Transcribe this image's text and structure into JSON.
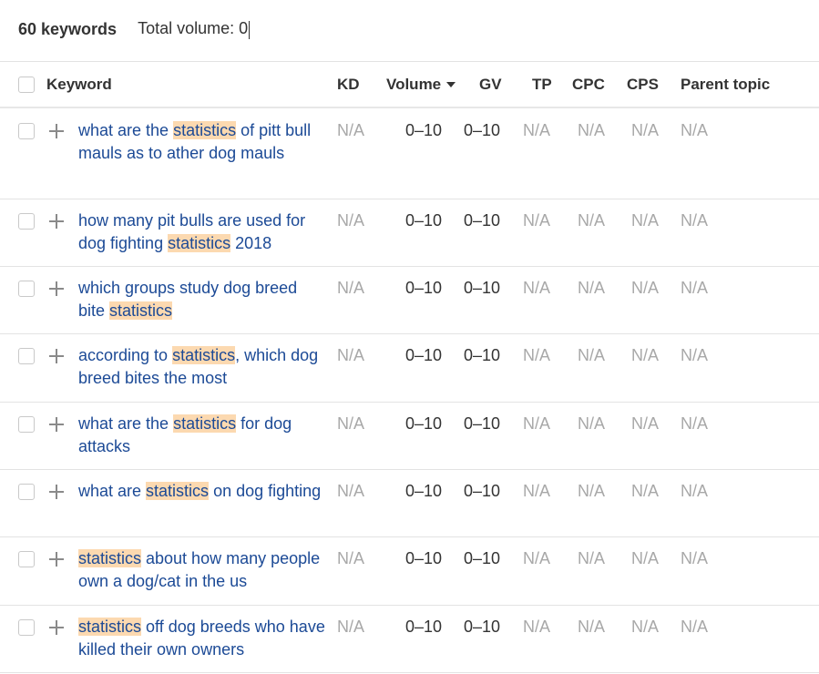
{
  "summary": {
    "keywords_count": "60 keywords",
    "total_volume_label": "Total volume: ",
    "total_volume_value": "0"
  },
  "columns": {
    "keyword": "Keyword",
    "kd": "KD",
    "volume": "Volume",
    "gv": "GV",
    "tp": "TP",
    "cpc": "CPC",
    "cps": "CPS",
    "parent_topic": "Parent topic"
  },
  "sort": {
    "column": "Volume",
    "direction": "descending",
    "icon": "caret-down-icon"
  },
  "highlight_term": "statistics",
  "colors": {
    "keyword_link": "#1c4a96",
    "highlight": "#fcd9b0",
    "na_text": "#a8a8a8"
  },
  "rows": [
    {
      "keyword_parts": [
        {
          "text": "what are the ",
          "hl": false
        },
        {
          "text": "statistics",
          "hl": true
        },
        {
          "text": " of pitt bull mauls as to ather dog mauls",
          "hl": false
        }
      ],
      "kd": "N/A",
      "volume": "0–10",
      "gv": "0–10",
      "tp": "N/A",
      "cpc": "N/A",
      "cps": "N/A",
      "parent_topic": "N/A"
    },
    {
      "keyword_parts": [
        {
          "text": "how many pit bulls are used for dog fighting ",
          "hl": false
        },
        {
          "text": "statistics",
          "hl": true
        },
        {
          "text": " 2018",
          "hl": false
        }
      ],
      "kd": "N/A",
      "volume": "0–10",
      "gv": "0–10",
      "tp": "N/A",
      "cpc": "N/A",
      "cps": "N/A",
      "parent_topic": "N/A"
    },
    {
      "keyword_parts": [
        {
          "text": "which groups study dog breed bite ",
          "hl": false
        },
        {
          "text": "statistics",
          "hl": true
        }
      ],
      "kd": "N/A",
      "volume": "0–10",
      "gv": "0–10",
      "tp": "N/A",
      "cpc": "N/A",
      "cps": "N/A",
      "parent_topic": "N/A"
    },
    {
      "keyword_parts": [
        {
          "text": "according to ",
          "hl": false
        },
        {
          "text": "statistics",
          "hl": true
        },
        {
          "text": ", which dog breed bites the most",
          "hl": false
        }
      ],
      "kd": "N/A",
      "volume": "0–10",
      "gv": "0–10",
      "tp": "N/A",
      "cpc": "N/A",
      "cps": "N/A",
      "parent_topic": "N/A"
    },
    {
      "keyword_parts": [
        {
          "text": "what are the ",
          "hl": false
        },
        {
          "text": "statistics",
          "hl": true
        },
        {
          "text": " for dog attacks",
          "hl": false
        }
      ],
      "kd": "N/A",
      "volume": "0–10",
      "gv": "0–10",
      "tp": "N/A",
      "cpc": "N/A",
      "cps": "N/A",
      "parent_topic": "N/A"
    },
    {
      "keyword_parts": [
        {
          "text": "what are ",
          "hl": false
        },
        {
          "text": "statistics",
          "hl": true
        },
        {
          "text": " on dog fighting",
          "hl": false
        }
      ],
      "kd": "N/A",
      "volume": "0–10",
      "gv": "0–10",
      "tp": "N/A",
      "cpc": "N/A",
      "cps": "N/A",
      "parent_topic": "N/A"
    },
    {
      "keyword_parts": [
        {
          "text": "statistics",
          "hl": true
        },
        {
          "text": " about how many people own a dog/cat in the us",
          "hl": false
        }
      ],
      "kd": "N/A",
      "volume": "0–10",
      "gv": "0–10",
      "tp": "N/A",
      "cpc": "N/A",
      "cps": "N/A",
      "parent_topic": "N/A"
    },
    {
      "keyword_parts": [
        {
          "text": "statistics",
          "hl": true
        },
        {
          "text": " off dog breeds who have killed their own owners",
          "hl": false
        }
      ],
      "kd": "N/A",
      "volume": "0–10",
      "gv": "0–10",
      "tp": "N/A",
      "cpc": "N/A",
      "cps": "N/A",
      "parent_topic": "N/A"
    }
  ]
}
